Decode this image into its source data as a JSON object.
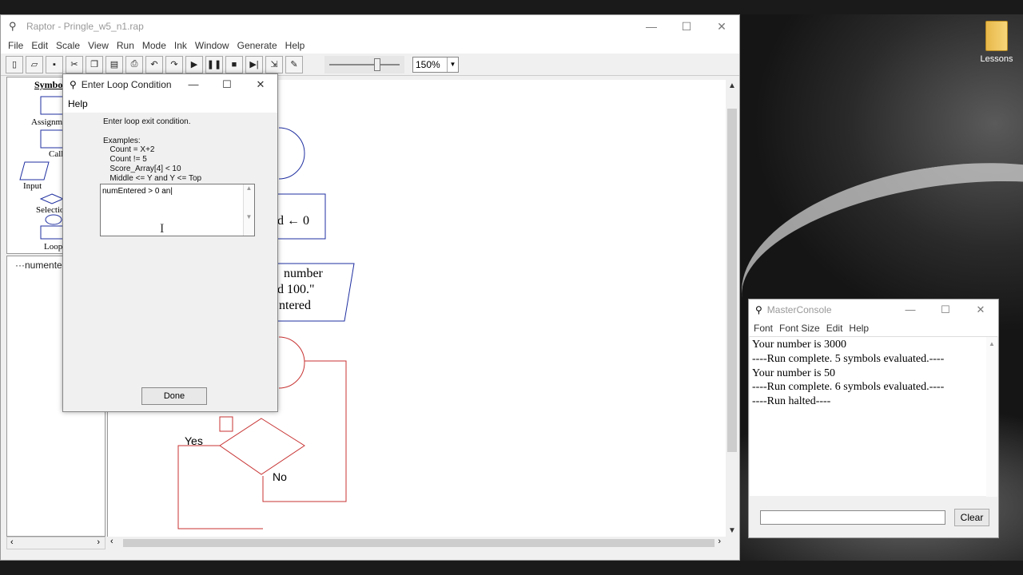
{
  "desktop": {
    "icon_label": "Lessons"
  },
  "raptor": {
    "title": "Raptor - Pringle_w5_n1.rap",
    "menu": [
      "File",
      "Edit",
      "Scale",
      "View",
      "Run",
      "Mode",
      "Ink",
      "Window",
      "Generate",
      "Help"
    ],
    "zoom": "150%",
    "palette": {
      "title": "Symbols",
      "items": [
        "Assignment",
        "Call",
        "Input",
        "Selection",
        "Loop"
      ]
    },
    "variables": [
      "numentered"
    ],
    "flow": {
      "assign_text": "d ← 0",
      "output_line1": "number",
      "output_line2": "d 100.\"",
      "output_line3": "ntered",
      "yes_label": "Yes",
      "no_label": "No"
    }
  },
  "dialog": {
    "title": "Enter Loop Condition",
    "menu_help": "Help",
    "instruction": "Enter loop exit condition.",
    "examples_label": "Examples:",
    "examples": [
      "Count = X+2",
      "Count != 5",
      "Score_Array[4] < 10",
      "Middle <= Y and Y <= Top"
    ],
    "condition_value": "numEntered > 0 an",
    "done_label": "Done"
  },
  "console": {
    "title": "MasterConsole",
    "menu": [
      "Font",
      "Font Size",
      "Edit",
      "Help"
    ],
    "lines": [
      "Your number is 3000",
      "----Run complete.  5 symbols evaluated.----",
      "Your number is 50",
      "----Run complete.  6 symbols evaluated.----",
      "----Run halted----"
    ],
    "clear_label": "Clear"
  }
}
